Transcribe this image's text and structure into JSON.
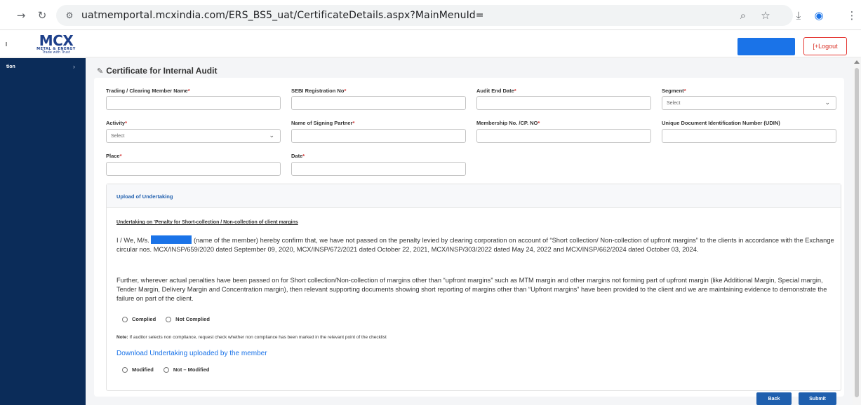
{
  "browser": {
    "url": "uatmemportal.mcxindia.com/ERS_BS5_uat/CertificateDetails.aspx?MainMenuId="
  },
  "header": {
    "logo": {
      "brand": "MCX",
      "sub": "METAL & ENERGY",
      "tagline": "Trade with Trust"
    },
    "logout_label": "[+Logout",
    "accent": "#1a73e8"
  },
  "sidebar": {
    "item_label": "tion"
  },
  "page": {
    "title": "Certificate for Internal Audit"
  },
  "form": {
    "member_name": {
      "label": "Trading / Clearing Member Name",
      "value": ""
    },
    "sebi_reg": {
      "label": "SEBI Registration No",
      "value": ""
    },
    "audit_end_date": {
      "label": "Audit End Date",
      "value": ""
    },
    "segment": {
      "label": "Segment",
      "value": "Select"
    },
    "activity": {
      "label": "Activity",
      "value": "Select"
    },
    "signing_partner": {
      "label": "Name of Signing Partner",
      "value": ""
    },
    "membership_no": {
      "label": "Membership No. /CP. NO",
      "value": ""
    },
    "udin": {
      "label": "Unique Document Identification Number (UDIN)",
      "value": ""
    },
    "place": {
      "label": "Place",
      "value": ""
    },
    "date": {
      "label": "Date",
      "value": ""
    }
  },
  "undertaking": {
    "panel_title": "Upload of Undertaking",
    "heading": "Undertaking on 'Penalty for Short-collection / Non-collection of client margins",
    "para1_prefix": "I / We, M/s.",
    "para1_rest": "(name of the member) hereby confirm that, we have not passed on the penalty levied by clearing corporation on account of “Short collection/ Non-collection of upfront margins” to the clients in accordance with the Exchange circular nos. MCX/INSP/659/2020 dated September 09, 2020, MCX/INSP/672/2021 dated October 22, 2021, MCX/INSP/303/2022 dated May 24, 2022 and MCX/INSP/662/2024 dated October 03, 2024.",
    "para2": "Further, wherever actual penalties have been passed on for Short collection/Non-collection of margins other than “upfront margins” such as MTM margin and other margins not forming part of upfront margin (like Additional Margin, Special margin, Tender Margin, Delivery Margin and Concentration margin), then relevant supporting documents showing short reporting of margins other than “Upfront margins” have been provided to the client and we are maintaining evidence to demonstrate the failure on part of the client.",
    "complied_label": "Complied",
    "not_complied_label": "Not Complied",
    "note_bold": "Note:",
    "note_text": "If auditor selects non compliance, request check whether non compliance has been marked in the relevant point of the checklist",
    "download_link": "Download Undertaking uploaded by the member",
    "modified_label": "Modified",
    "not_modified_label": "Not – Modified"
  },
  "actions": {
    "back_label": "Back",
    "submit_label": "Submit"
  }
}
